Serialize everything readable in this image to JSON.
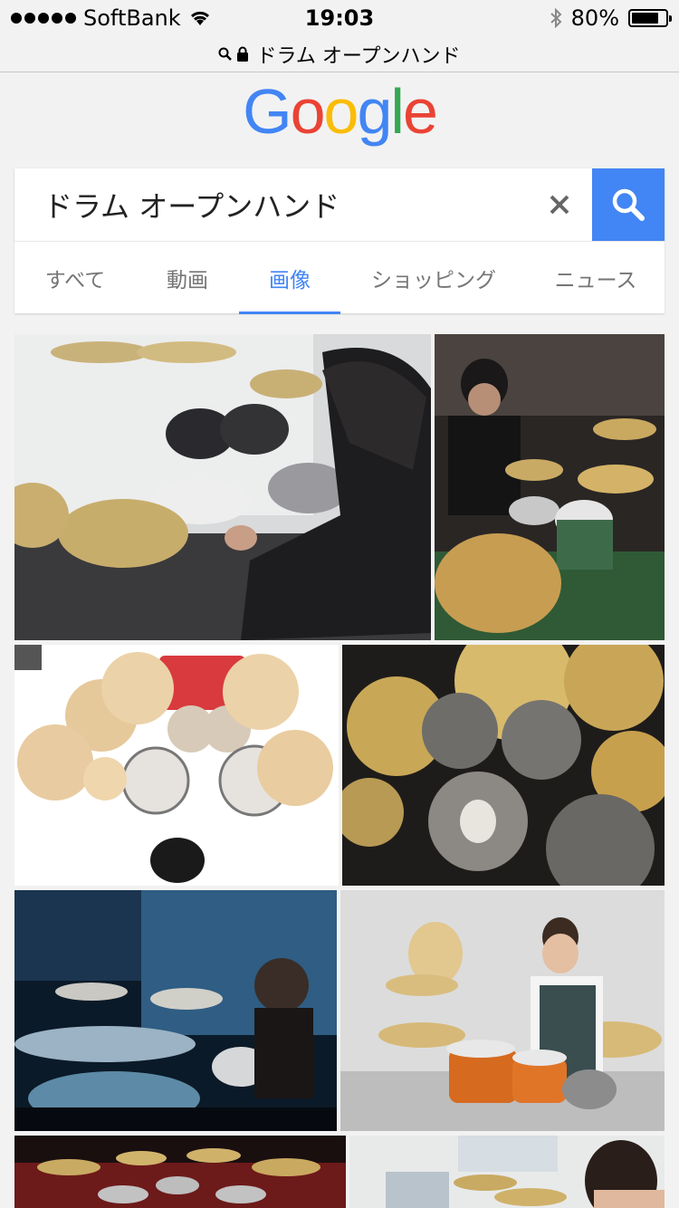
{
  "status_bar": {
    "carrier": "SoftBank",
    "time": "19:03",
    "battery_percent": "80%",
    "battery_level": 0.8
  },
  "url_bar": {
    "title": "ドラム オープンハンド"
  },
  "logo": {
    "text": [
      "G",
      "o",
      "o",
      "g",
      "l",
      "e"
    ],
    "colors": [
      "#4285f4",
      "#ea4335",
      "#fbbc05",
      "#4285f4",
      "#34a853",
      "#ea4335"
    ]
  },
  "search": {
    "query": "ドラム オープンハンド",
    "clear_icon": "close-icon",
    "search_icon": "search-icon",
    "accent": "#4285f4"
  },
  "tabs": [
    {
      "label": "すべて",
      "active": false
    },
    {
      "label": "動画",
      "active": false
    },
    {
      "label": "画像",
      "active": true
    },
    {
      "label": "ショッピング",
      "active": false
    },
    {
      "label": "ニュース",
      "active": false
    }
  ],
  "results": [
    {
      "name": "drummer-long-hair-studio"
    },
    {
      "name": "drummer-dark-room"
    },
    {
      "name": "drum-kit-product-top-view"
    },
    {
      "name": "drum-kit-overhead-dark"
    },
    {
      "name": "drummer-blue-stage"
    },
    {
      "name": "drummer-orange-kit"
    },
    {
      "name": "drum-kit-red-stage"
    },
    {
      "name": "drummer-white-room"
    }
  ]
}
